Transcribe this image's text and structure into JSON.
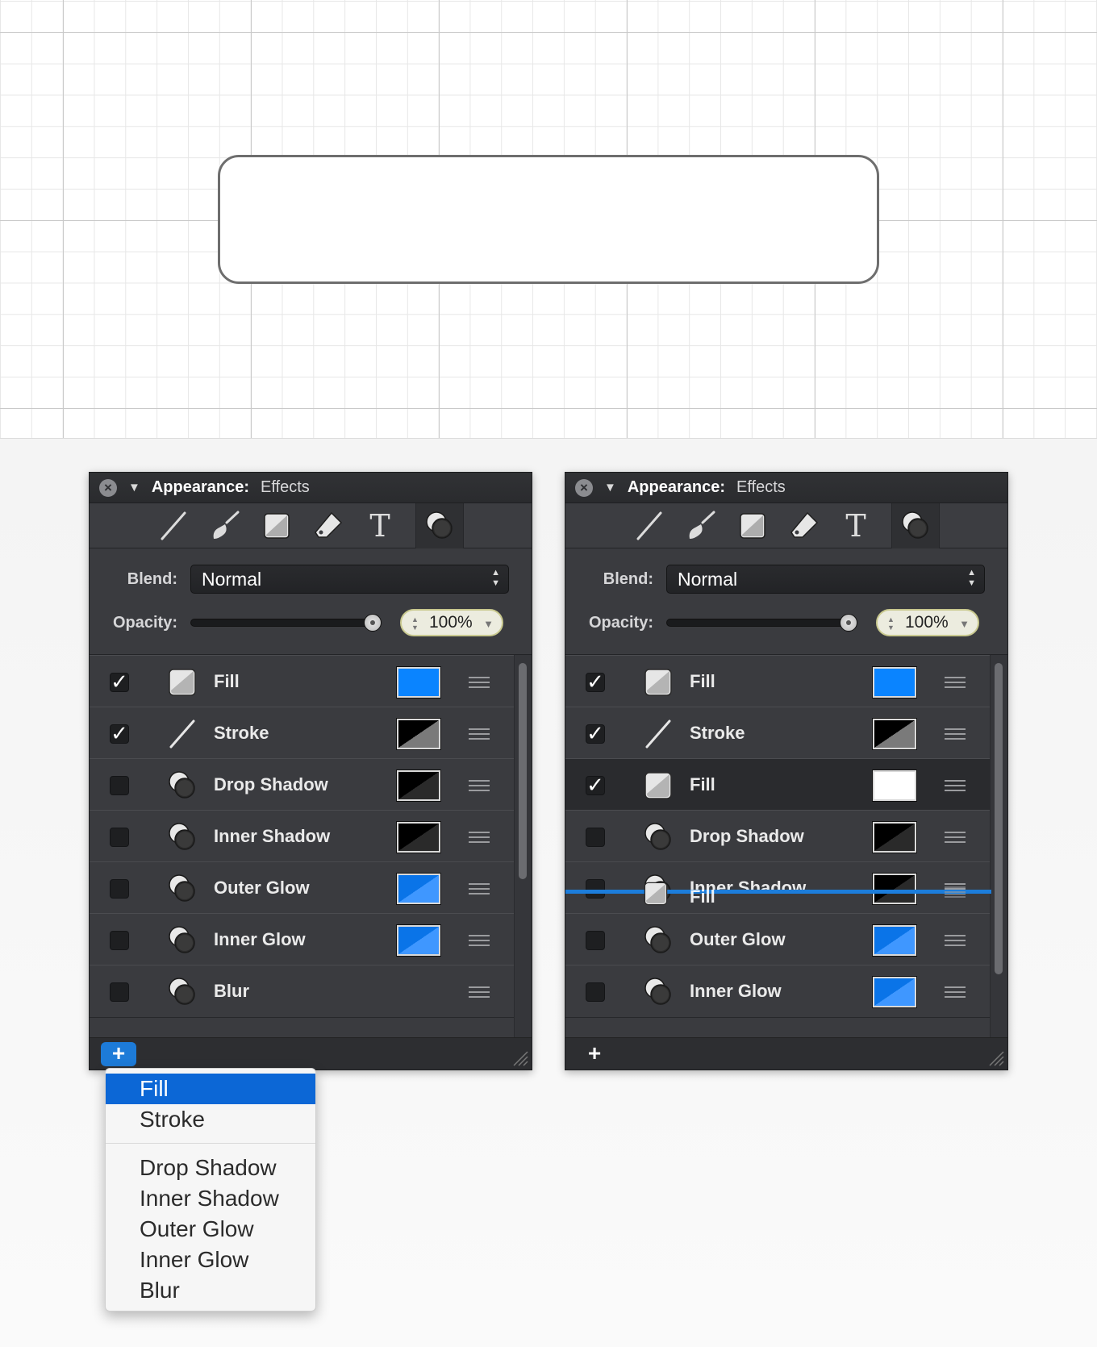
{
  "canvas": {},
  "panels": [
    {
      "title_label": "Appearance:",
      "title_sub": "Effects",
      "blend_label": "Blend:",
      "blend_value": "Normal",
      "opacity_label": "Opacity:",
      "opacity_value": "100%",
      "opacity_slider_percent": 100,
      "add_button": "+",
      "add_button_active": true,
      "rows": [
        {
          "label": "Fill",
          "checked": true,
          "icon": "fill-icon",
          "swatch": "#0a84ff"
        },
        {
          "label": "Stroke",
          "checked": true,
          "icon": "stroke-icon",
          "swatch": "black-gray-diagonal"
        },
        {
          "label": "Drop Shadow",
          "checked": false,
          "icon": "effect-icon",
          "swatch": "black-dark-diagonal"
        },
        {
          "label": "Inner Shadow",
          "checked": false,
          "icon": "effect-icon",
          "swatch": "black-dark-diagonal"
        },
        {
          "label": "Outer Glow",
          "checked": false,
          "icon": "effect-icon",
          "swatch": "blue-diagonal"
        },
        {
          "label": "Inner Glow",
          "checked": false,
          "icon": "effect-icon",
          "swatch": "blue-diagonal"
        },
        {
          "label": "Blur",
          "checked": false,
          "icon": "effect-icon",
          "swatch": null
        }
      ]
    },
    {
      "title_label": "Appearance:",
      "title_sub": "Effects",
      "blend_label": "Blend:",
      "blend_value": "Normal",
      "opacity_label": "Opacity:",
      "opacity_value": "100%",
      "opacity_slider_percent": 100,
      "add_button": "+",
      "add_button_active": false,
      "drag_ghost_label": "Fill",
      "rows": [
        {
          "label": "Fill",
          "checked": true,
          "icon": "fill-icon",
          "swatch": "#0a84ff"
        },
        {
          "label": "Stroke",
          "checked": true,
          "icon": "stroke-icon",
          "swatch": "black-gray-diagonal"
        },
        {
          "label": "Fill",
          "checked": true,
          "icon": "fill-icon",
          "swatch": "#ffffff",
          "highlighted": true
        },
        {
          "label": "Drop Shadow",
          "checked": false,
          "icon": "effect-icon",
          "swatch": "black-dark-diagonal"
        },
        {
          "label": "Inner Shadow",
          "checked": false,
          "icon": "effect-icon",
          "swatch": "black-dark-diagonal"
        },
        {
          "label": "Outer Glow",
          "checked": false,
          "icon": "effect-icon",
          "swatch": "blue-diagonal"
        },
        {
          "label": "Inner Glow",
          "checked": false,
          "icon": "effect-icon",
          "swatch": "blue-diagonal"
        }
      ]
    }
  ],
  "menu": {
    "group1": [
      "Fill",
      "Stroke"
    ],
    "group2": [
      "Drop Shadow",
      "Inner Shadow",
      "Outer Glow",
      "Inner Glow",
      "Blur"
    ],
    "selected": "Fill"
  },
  "colors": {
    "panel_bg": "#3a3b3f",
    "accent_blue": "#1d7bd8",
    "menu_selected": "#0c67d6",
    "fill_blue": "#0a84ff"
  },
  "toolbar_icons": [
    "line-tool-icon",
    "brush-tool-icon",
    "square-tool-icon",
    "eraser-tool-icon",
    "text-tool-icon",
    "effects-tool-icon"
  ]
}
